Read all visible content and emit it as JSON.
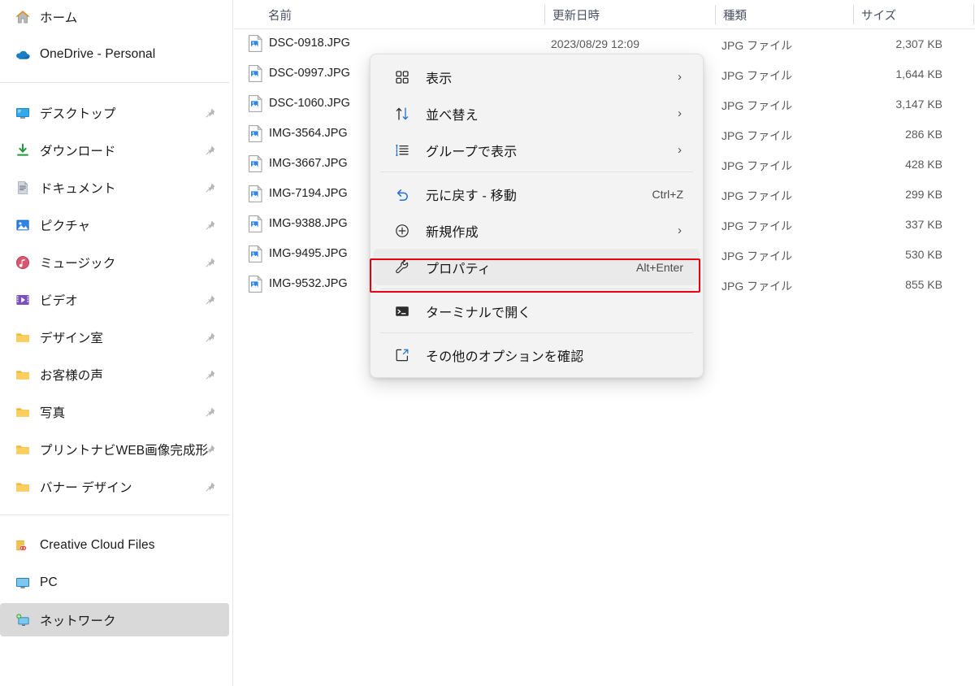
{
  "sidebar": {
    "groups": [
      {
        "items": [
          {
            "label": "ホーム",
            "icon": "home-icon",
            "pinned": false,
            "selected": false
          },
          {
            "label": "OneDrive - Personal",
            "icon": "onedrive-cloud-icon",
            "pinned": false,
            "selected": false
          }
        ]
      },
      {
        "items": [
          {
            "label": "デスクトップ",
            "icon": "desktop-icon",
            "pinned": true,
            "selected": false
          },
          {
            "label": "ダウンロード",
            "icon": "downloads-icon",
            "pinned": true,
            "selected": false
          },
          {
            "label": "ドキュメント",
            "icon": "documents-icon",
            "pinned": true,
            "selected": false
          },
          {
            "label": "ピクチャ",
            "icon": "pictures-icon",
            "pinned": true,
            "selected": false
          },
          {
            "label": "ミュージック",
            "icon": "music-icon",
            "pinned": true,
            "selected": false
          },
          {
            "label": "ビデオ",
            "icon": "videos-icon",
            "pinned": true,
            "selected": false
          },
          {
            "label": "デザイン室",
            "icon": "folder-icon",
            "pinned": true,
            "selected": false
          },
          {
            "label": "お客様の声",
            "icon": "folder-icon",
            "pinned": true,
            "selected": false
          },
          {
            "label": "写真",
            "icon": "folder-icon",
            "pinned": true,
            "selected": false
          },
          {
            "label": "プリントナビWEB画像完成形",
            "icon": "folder-icon",
            "pinned": true,
            "selected": false
          },
          {
            "label": "バナー デザイン",
            "icon": "folder-icon",
            "pinned": true,
            "selected": false
          }
        ]
      },
      {
        "items": [
          {
            "label": "Creative Cloud Files",
            "icon": "creative-cloud-folder-icon",
            "pinned": false,
            "selected": false
          },
          {
            "label": "PC",
            "icon": "pc-monitor-icon",
            "pinned": false,
            "selected": false
          },
          {
            "label": "ネットワーク",
            "icon": "network-icon",
            "pinned": false,
            "selected": true
          }
        ]
      }
    ]
  },
  "file_list": {
    "columns": [
      {
        "key": "name",
        "label": "名前",
        "sorted": true,
        "sort_direction": "asc",
        "sort_glyph": "⌃"
      },
      {
        "key": "date",
        "label": "更新日時",
        "sorted": false
      },
      {
        "key": "type",
        "label": "種類",
        "sorted": false
      },
      {
        "key": "size",
        "label": "サイズ",
        "sorted": false
      }
    ],
    "rows": [
      {
        "name": "DSC-0918.JPG",
        "date": "2023/08/29 12:09",
        "type": "JPG ファイル",
        "size": "2,307 KB",
        "icon": "jpg-file-icon"
      },
      {
        "name": "DSC-0997.JPG",
        "date": "",
        "type": "JPG ファイル",
        "size": "1,644 KB",
        "icon": "jpg-file-icon"
      },
      {
        "name": "DSC-1060.JPG",
        "date": "",
        "type": "JPG ファイル",
        "size": "3,147 KB",
        "icon": "jpg-file-icon"
      },
      {
        "name": "IMG-3564.JPG",
        "date": "",
        "type": "JPG ファイル",
        "size": "286 KB",
        "icon": "jpg-file-icon"
      },
      {
        "name": "IMG-3667.JPG",
        "date": "",
        "type": "JPG ファイル",
        "size": "428 KB",
        "icon": "jpg-file-icon"
      },
      {
        "name": "IMG-7194.JPG",
        "date": "",
        "type": "JPG ファイル",
        "size": "299 KB",
        "icon": "jpg-file-icon"
      },
      {
        "name": "IMG-9388.JPG",
        "date": "",
        "type": "JPG ファイル",
        "size": "337 KB",
        "icon": "jpg-file-icon"
      },
      {
        "name": "IMG-9495.JPG",
        "date": "",
        "type": "JPG ファイル",
        "size": "530 KB",
        "icon": "jpg-file-icon"
      },
      {
        "name": "IMG-9532.JPG",
        "date": "",
        "type": "JPG ファイル",
        "size": "855 KB",
        "icon": "jpg-file-icon"
      }
    ]
  },
  "context_menu": {
    "items": [
      {
        "label": "表示",
        "icon": "grid-view-icon",
        "submenu": true,
        "accel": "",
        "highlighted": false,
        "separator_after": false
      },
      {
        "label": "並べ替え",
        "icon": "sort-arrows-icon",
        "submenu": true,
        "accel": "",
        "highlighted": false,
        "separator_after": false
      },
      {
        "label": "グループで表示",
        "icon": "group-list-icon",
        "submenu": true,
        "accel": "",
        "highlighted": false,
        "separator_after": true
      },
      {
        "label": "元に戻す - 移動",
        "icon": "undo-arrow-icon",
        "submenu": false,
        "accel": "Ctrl+Z",
        "highlighted": false,
        "separator_after": false
      },
      {
        "label": "新規作成",
        "icon": "plus-circle-icon",
        "submenu": true,
        "accel": "",
        "highlighted": false,
        "separator_after": false
      },
      {
        "label": "プロパティ",
        "icon": "wrench-icon",
        "submenu": false,
        "accel": "Alt+Enter",
        "highlighted": true,
        "separator_after": true
      },
      {
        "label": "ターミナルで開く",
        "icon": "terminal-icon",
        "submenu": false,
        "accel": "",
        "highlighted": false,
        "separator_after": true
      },
      {
        "label": "その他のオプションを確認",
        "icon": "more-options-expand-icon",
        "submenu": false,
        "accel": "",
        "highlighted": false,
        "separator_after": false
      }
    ]
  },
  "annotation": {
    "highlight_color": "#e60012",
    "target_label": "プロパティ"
  }
}
